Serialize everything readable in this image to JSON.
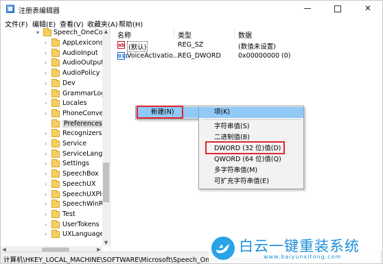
{
  "window": {
    "title": "注册表编辑器",
    "controls": {
      "minimize": "minimize",
      "maximize": "maximize",
      "close": "✕"
    }
  },
  "menubar": [
    "文件(F)",
    "编辑(E)",
    "查看(V)",
    "收藏夹(A)",
    "帮助(H)"
  ],
  "tree": {
    "parent": "Speech_OneCore",
    "children": [
      "AppLexicons",
      "AudioInput",
      "AudioOutput",
      "AudioPolicy",
      "Dev",
      "GrammarLog",
      "Locales",
      "PhoneConver",
      "Preferences",
      "Recognizers",
      "Service",
      "ServiceLangu",
      "Settings",
      "SpeechBox",
      "SpeechUX",
      "SpeechUXPlu",
      "SpeechWinRT",
      "Test",
      "UserTokens",
      "UXLanguages"
    ],
    "selected": "Preferences"
  },
  "values": {
    "columns": [
      "名称",
      "类型",
      "数据"
    ],
    "rows": [
      {
        "icon": "ab",
        "name": "(默认)",
        "type": "REG_SZ",
        "data": "(数值未设置)"
      },
      {
        "icon": "011",
        "name": "VoiceActivatio...",
        "type": "REG_DWORD",
        "data": "0x00000000 (0)"
      }
    ]
  },
  "context_menu": {
    "item": "新建(N)",
    "arrow": "›"
  },
  "submenu": {
    "items": [
      "项(K)",
      "字符串值(S)",
      "二进制值(B)",
      "DWORD (32 位)值(D)",
      "QWORD (64 位)值(Q)",
      "多字符串值(M)",
      "可扩充字符串值(E)"
    ],
    "highlighted": "项(K)",
    "boxed": "DWORD (32 位)值(D)"
  },
  "status": "计算机\\HKEY_LOCAL_MACHINE\\SOFTWARE\\Microsoft\\Speech_OneCore\\Preferences",
  "watermark": {
    "main": "白云一键重装系统",
    "sub": "www.baiyunxitong.com"
  },
  "colors": {
    "highlight": "#91c9f7",
    "red_box": "#e0262f",
    "watermark": "#1a8fd9"
  }
}
